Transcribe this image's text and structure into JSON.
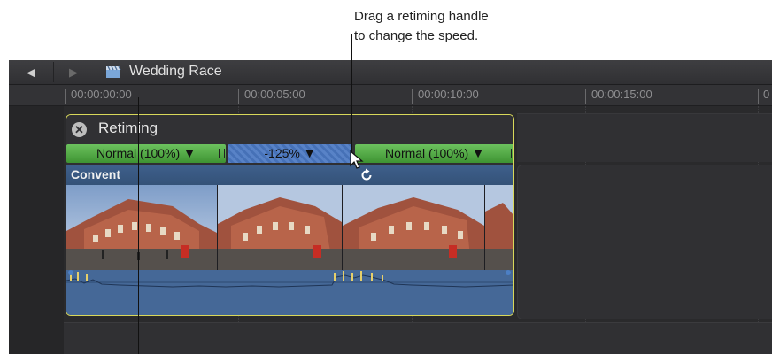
{
  "callout": {
    "line1": "Drag a retiming handle",
    "line2": "to change the speed."
  },
  "toolbar": {
    "back_icon": "triangle-left-icon",
    "forward_icon": "triangle-right-icon",
    "project_icon": "clapperboard-icon",
    "project_title": "Wedding Race"
  },
  "ruler": {
    "ticks": [
      "00:00:00:00",
      "00:00:05:00",
      "00:00:10:00",
      "00:00:15:00",
      "0"
    ]
  },
  "retime": {
    "label": "Retiming",
    "close_icon": "close-circle-icon",
    "segments": [
      {
        "label": "Normal (100%) ▼",
        "color": "#4fab42"
      },
      {
        "label": "-125% ▼",
        "color": "#4a78c2"
      },
      {
        "label": "Normal (100%) ▼",
        "color": "#4fab42"
      }
    ]
  },
  "clip": {
    "name": "Convent",
    "header_color": "#3a5a86",
    "audio_color": "#456897"
  },
  "colors": {
    "selection": "#d8d85a",
    "timeline_bg": "#2a2a2c"
  }
}
